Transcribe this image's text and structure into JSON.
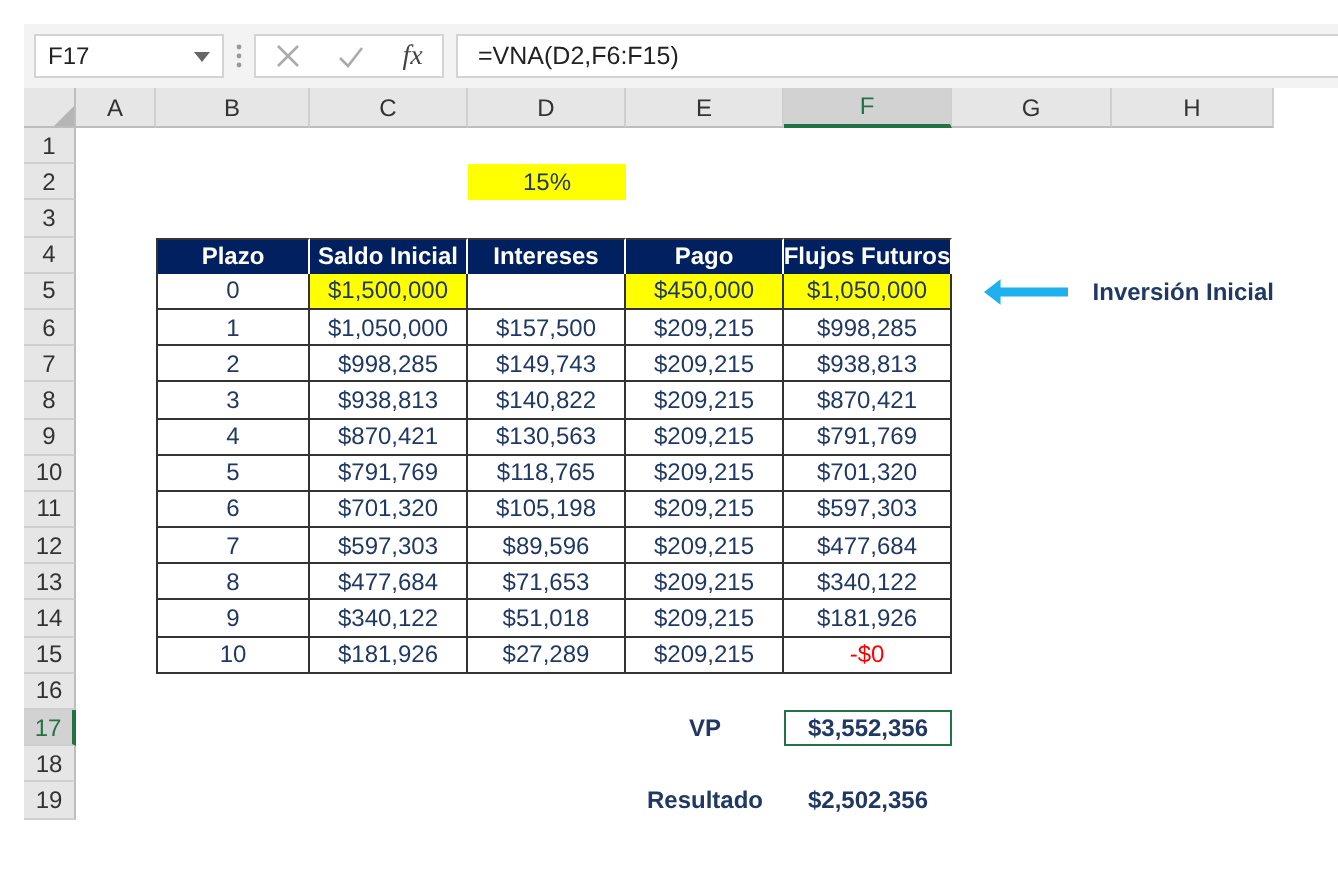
{
  "formula_bar": {
    "name_box": "F17",
    "function_label": "fx",
    "formula": "=VNA(D2,F6:F15)"
  },
  "column_headers": [
    {
      "label": "A",
      "selected": false
    },
    {
      "label": "B",
      "selected": false
    },
    {
      "label": "C",
      "selected": false
    },
    {
      "label": "D",
      "selected": false
    },
    {
      "label": "E",
      "selected": false
    },
    {
      "label": "F",
      "selected": true
    },
    {
      "label": "G",
      "selected": false
    },
    {
      "label": "H",
      "selected": false
    }
  ],
  "row_headers": [
    {
      "label": "1",
      "selected": false
    },
    {
      "label": "2",
      "selected": false
    },
    {
      "label": "3",
      "selected": false
    },
    {
      "label": "4",
      "selected": false
    },
    {
      "label": "5",
      "selected": false
    },
    {
      "label": "6",
      "selected": false
    },
    {
      "label": "7",
      "selected": false
    },
    {
      "label": "8",
      "selected": false
    },
    {
      "label": "9",
      "selected": false
    },
    {
      "label": "10",
      "selected": false
    },
    {
      "label": "11",
      "selected": false
    },
    {
      "label": "12",
      "selected": false
    },
    {
      "label": "13",
      "selected": false
    },
    {
      "label": "14",
      "selected": false
    },
    {
      "label": "15",
      "selected": false
    },
    {
      "label": "16",
      "selected": false
    },
    {
      "label": "17",
      "selected": true
    },
    {
      "label": "18",
      "selected": false
    },
    {
      "label": "19",
      "selected": false
    }
  ],
  "rate_cell": {
    "text": "15%",
    "highlighted": true
  },
  "table": {
    "columns": [
      "Plazo",
      "Saldo Inicial",
      "Intereses",
      "Pago",
      "Flujos Futuros"
    ],
    "rows": [
      [
        {
          "text": "0",
          "highlighted": false,
          "negative": false
        },
        {
          "text": "$1,500,000",
          "highlighted": true,
          "negative": false
        },
        {
          "highlighted": false
        },
        {
          "text": "$450,000",
          "highlighted": true,
          "negative": false
        },
        {
          "text": "$1,050,000",
          "highlighted": true,
          "negative": false
        }
      ],
      [
        {
          "text": "1",
          "highlighted": false,
          "negative": false
        },
        {
          "text": "$1,050,000",
          "highlighted": false,
          "negative": false
        },
        {
          "text": "$157,500",
          "highlighted": false,
          "negative": false
        },
        {
          "text": "$209,215",
          "highlighted": false,
          "negative": false
        },
        {
          "text": "$998,285",
          "highlighted": false,
          "negative": false
        }
      ],
      [
        {
          "text": "2",
          "highlighted": false,
          "negative": false
        },
        {
          "text": "$998,285",
          "highlighted": false,
          "negative": false
        },
        {
          "text": "$149,743",
          "highlighted": false,
          "negative": false
        },
        {
          "text": "$209,215",
          "highlighted": false,
          "negative": false
        },
        {
          "text": "$938,813",
          "highlighted": false,
          "negative": false
        }
      ],
      [
        {
          "text": "3",
          "highlighted": false,
          "negative": false
        },
        {
          "text": "$938,813",
          "highlighted": false,
          "negative": false
        },
        {
          "text": "$140,822",
          "highlighted": false,
          "negative": false
        },
        {
          "text": "$209,215",
          "highlighted": false,
          "negative": false
        },
        {
          "text": "$870,421",
          "highlighted": false,
          "negative": false
        }
      ],
      [
        {
          "text": "4",
          "highlighted": false,
          "negative": false
        },
        {
          "text": "$870,421",
          "highlighted": false,
          "negative": false
        },
        {
          "text": "$130,563",
          "highlighted": false,
          "negative": false
        },
        {
          "text": "$209,215",
          "highlighted": false,
          "negative": false
        },
        {
          "text": "$791,769",
          "highlighted": false,
          "negative": false
        }
      ],
      [
        {
          "text": "5",
          "highlighted": false,
          "negative": false
        },
        {
          "text": "$791,769",
          "highlighted": false,
          "negative": false
        },
        {
          "text": "$118,765",
          "highlighted": false,
          "negative": false
        },
        {
          "text": "$209,215",
          "highlighted": false,
          "negative": false
        },
        {
          "text": "$701,320",
          "highlighted": false,
          "negative": false
        }
      ],
      [
        {
          "text": "6",
          "highlighted": false,
          "negative": false
        },
        {
          "text": "$701,320",
          "highlighted": false,
          "negative": false
        },
        {
          "text": "$105,198",
          "highlighted": false,
          "negative": false
        },
        {
          "text": "$209,215",
          "highlighted": false,
          "negative": false
        },
        {
          "text": "$597,303",
          "highlighted": false,
          "negative": false
        }
      ],
      [
        {
          "text": "7",
          "highlighted": false,
          "negative": false
        },
        {
          "text": "$597,303",
          "highlighted": false,
          "negative": false
        },
        {
          "text": "$89,596",
          "highlighted": false,
          "negative": false
        },
        {
          "text": "$209,215",
          "highlighted": false,
          "negative": false
        },
        {
          "text": "$477,684",
          "highlighted": false,
          "negative": false
        }
      ],
      [
        {
          "text": "8",
          "highlighted": false,
          "negative": false
        },
        {
          "text": "$477,684",
          "highlighted": false,
          "negative": false
        },
        {
          "text": "$71,653",
          "highlighted": false,
          "negative": false
        },
        {
          "text": "$209,215",
          "highlighted": false,
          "negative": false
        },
        {
          "text": "$340,122",
          "highlighted": false,
          "negative": false
        }
      ],
      [
        {
          "text": "9",
          "highlighted": false,
          "negative": false
        },
        {
          "text": "$340,122",
          "highlighted": false,
          "negative": false
        },
        {
          "text": "$51,018",
          "highlighted": false,
          "negative": false
        },
        {
          "text": "$209,215",
          "highlighted": false,
          "negative": false
        },
        {
          "text": "$181,926",
          "highlighted": false,
          "negative": false
        }
      ],
      [
        {
          "text": "10",
          "highlighted": false,
          "negative": false
        },
        {
          "text": "$181,926",
          "highlighted": false,
          "negative": false
        },
        {
          "text": "$27,289",
          "highlighted": false,
          "negative": false
        },
        {
          "text": "$209,215",
          "highlighted": false,
          "negative": false
        },
        {
          "text": "-$0",
          "highlighted": false,
          "negative": true
        }
      ]
    ]
  },
  "annotation": {
    "text": "Inversión Inicial"
  },
  "summary": [
    {
      "label": "VP",
      "value": "$3,552,356",
      "selected": true
    },
    {
      "label": "Resultado",
      "value": "$2,502,356",
      "selected": false
    }
  ]
}
